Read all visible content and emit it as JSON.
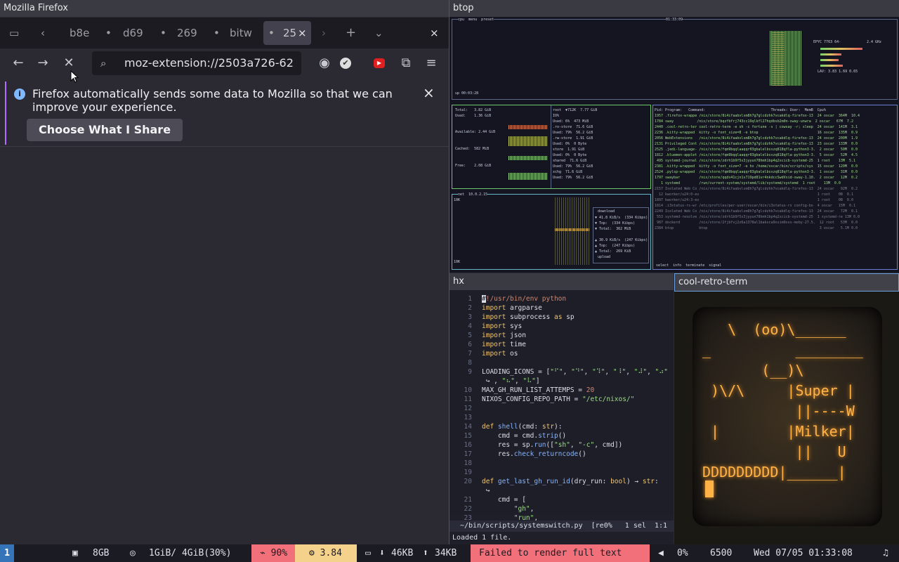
{
  "firefox": {
    "window_title": "Mozilla Firefox",
    "tabs": [
      "b8e",
      "d69",
      "269",
      "bitw",
      "25"
    ],
    "url": "moz-extension://2503a726-62",
    "notification": {
      "text": "Firefox automatically sends some data to Mozilla so that we can improve your experience.",
      "button": "Choose What I Share"
    }
  },
  "btop": {
    "window_title": "btop",
    "cpu_header": "cpu  menu  preset",
    "clock": "01:33:09",
    "cpu_model": "EPYC 7763 64-",
    "cpu_freq": "2.4 GHz",
    "uptime": "up 00:03:28",
    "load": "LAV: 3.83 1.69 0.65",
    "mem": {
      "total": "Total:   3.82 GiB",
      "used": "Used:    1.36 GiB",
      "available": "Available: 2.44 GiB",
      "cached": "Cached:  582 MiB",
      "free": "Free:    2.08 GiB"
    },
    "disks": [
      "root  ▼712K  7.77 GiB",
      "IO%",
      "Used: 6%  473 MiB",
      ".ro-store  71.6 GiB",
      "Used: 79%  56.2 GiB",
      ".rw-store  1.91 GiB",
      "Used: 0%  0 Byte",
      "store  1.91 GiB",
      "Used: 0%  0 Byte",
      "shared  71.6 GiB",
      "Used: 79%  56.2 GiB",
      "xchg  71.6 GiB",
      "Used: 79%  56.2 GiB"
    ],
    "net": {
      "header": "net  10.0.2.15",
      "download": "download",
      "down_rate": "▼ 41.8 KiB/s  (334 Kibps)",
      "down_top": "▼ Top:  (334 Kibps)",
      "down_total": "▼ Total:  362 MiB",
      "up_rate": "▲ 30.9 KiB/s  (247 Kibps)",
      "up_top": "▲ Top:  (247 Kibps)",
      "up_total": "▲ Total:  269 KiB",
      "upload": "upload",
      "scale_top": "10K",
      "scale_bottom": "10K"
    },
    "proc_header": "Pid: Program:   Command:                               Threads: User:  MemB  Cpu%",
    "procs": [
      "1957 .firefox-wrappe /nix/store/8i4ifaabvlsm8h7g7glcdzhk7vcakdlq-firefox-13  24 oscar  364M  10.4",
      "1784 sway           /nix/store/bqzfbfrj743cc19qlkfl27hqdbsb2m0n-sway-unwra  2 oscar   67M  7.2",
      "2440 .cool-retro-ter cool-retro-term -e sh -c fortune -s | cowsay -r; sleep  24 oscar  141M  3.1",
      "2236 .kitty-wrapped  kitty -o font_size=8 -e btop                            16 oscar  135M  0.9",
      "2056 WebExtensions   /nix/store/8i4ifaabvlsm8h7g7glcdzhk7vcakdlq-firefox-13  24 oscar  200M  1.9",
      "2131 Privileged Cont /nix/store/8i4ifaabvlsm8h7g7glcdzhk7vcakdlq-firefox-13  23 oscar  133M  0.0",
      "2525 .jedi-language- /nix/store/fqm9bqqlaaqqr03gbalelbsszq818qfla-python3-3.  2 oscar   50M  0.0",
      "1812 .bluemen-applet /nix/store/fqm9bqqlaaqqr03gbalelbsszq818qfla-python3-3.  5 oscar   52M  4.5",
      " 495 systemd-journal /nix/store/zdrh1b9f5x3jyyun78hmh1bp4q2xcicb-systemd-25  1 root    13M  5.1",
      "2381 .kitty-wrapped  kitty -o font_size=7 -e hx /home/oscar/bin/scripts/sys  15 oscar  120M  0.0",
      "2524 .pylsp-wrapped  /nix/store/fqm9bqqlaaqqr03gbalelbsszq818qfla-python3-3.  1 oscar   31M  0.0",
      "1797 swaybar         /nix/store/qqds41cjn1s719pd81vr4nkdccSwdVxid-sway-1.10.  2 oscar   12M  0.2",
      "   1 systemd         /run/current-system/systemd/lib/systemd/systemd  1 root    13M  0.0",
      "2157 Isolated Web Co /nix/store/8i4ifaabvlsm8h7g7glcdzhk7vcakdlq-firefox-13  24 oscar   92M  0.2",
      "  12 kworker/u24:0-ev                                                        1 root    0B  0.1",
      "1897 kworker/u24:3-ev                                                        1 root    0B  0.0",
      "1814 .i3status-rs-wr /etc/profiles/per-user/oscar/bin/i3status-rs config-bo  4 oscar   15M  0.1",
      "2249 Isolated Web Co /nix/store/8i4ifaabvlsm8h7g7glcdzhk7vcakdlq-firefox-13  24 oscar   72M  0.1",
      " 553 systemd-resolve /nix/store/zdrh1b9f5x3jyyun78hmh1bp4q2xcicb-systemd-25  1 systemd-re 13M 0.0",
      " 987 dockerd         /nix/store/2fjbfvj2z6a1378al1baksca9ssim9sss-moby-27.5.  12 root   53M  0.0",
      "2384 btop            btop                                                     3 oscar   5.1M 0.0"
    ],
    "proc_footer": "select  info  terminate  signal"
  },
  "hx": {
    "window_title": "hx",
    "line_numbers": [
      "1",
      "2",
      "3",
      "4",
      "5",
      "6",
      "7",
      "8",
      "9",
      "",
      "10",
      "11",
      "12",
      "13",
      "14",
      "15",
      "16",
      "17",
      "18",
      "19",
      "20",
      "",
      "21",
      "22",
      "23"
    ],
    "status": "~/bin/scripts/systemswitch.py  [re0%   1 sel  1:1",
    "message": "Loaded 1 file."
  },
  "crt": {
    "window_title": "cool-retro-term",
    "screen_text": "   \\  (oo)\\______\n_          ________\n       (__)\\  \n )\\/\\     |Super |\n           ||----W\n |        |Milker|\n           ||   U\nDDDDDDDDD|______|"
  },
  "statusbar": {
    "workspace": "1",
    "mem_total": "8GB",
    "mem_used": "1GiB/ 4GiB(30%)",
    "battery": "90%",
    "load": "3.84",
    "net_down": "46KB",
    "net_up": "34KB",
    "error": "Failed to render full text",
    "volume": "0%",
    "temp": "6500",
    "datetime": "Wed 07/05 01:33:08"
  },
  "colors": {
    "battery_bg": "#f2707a",
    "load_bg": "#f5d28b",
    "error_bg": "#f2707a",
    "crt_amber": "#ffb347",
    "workspace_active": "#3574b8"
  }
}
